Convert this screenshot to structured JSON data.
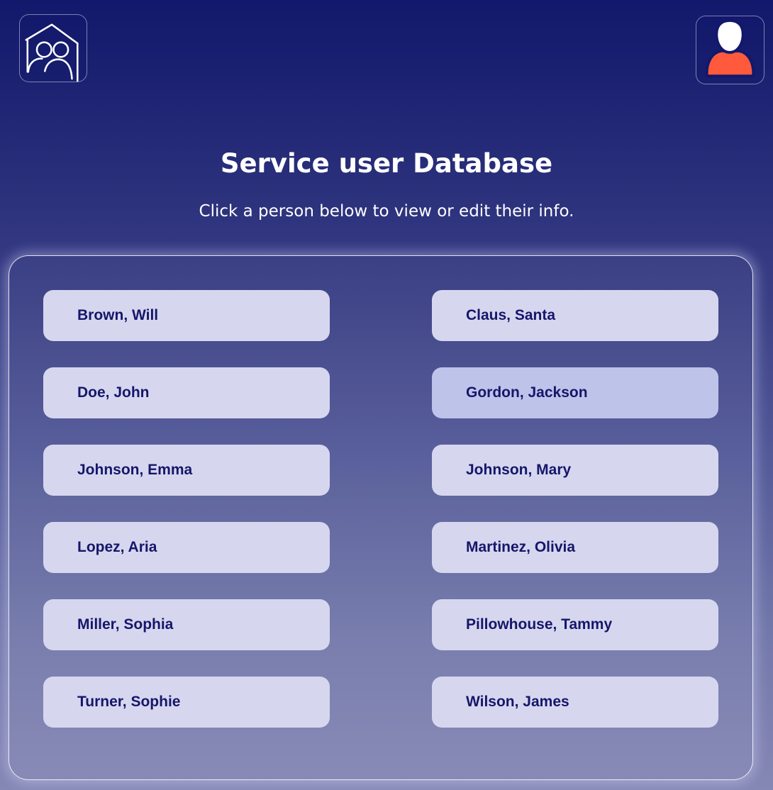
{
  "header": {
    "home_icon": "home-people-icon",
    "profile_icon": "user-avatar-icon",
    "profile_colors": {
      "head": "#ffffff",
      "body": "#ff5a3c",
      "outline": "#12186b"
    }
  },
  "page": {
    "title": "Service user Database",
    "subtitle": "Click a person below to view or edit their info."
  },
  "people": [
    {
      "name": "Brown, Will"
    },
    {
      "name": "Claus, Santa"
    },
    {
      "name": "Doe, John"
    },
    {
      "name": "Gordon, Jackson",
      "hovered": true
    },
    {
      "name": "Johnson, Emma"
    },
    {
      "name": "Johnson, Mary"
    },
    {
      "name": "Lopez, Aria"
    },
    {
      "name": "Martinez, Olivia"
    },
    {
      "name": "Miller, Sophia"
    },
    {
      "name": "Pillowhouse, Tammy"
    },
    {
      "name": "Turner, Sophie"
    },
    {
      "name": "Wilson, James"
    }
  ],
  "colors": {
    "card_background": "#d6d7ef",
    "card_hover_background": "#bec3e9",
    "card_text": "#16166a",
    "background_top": "#12186b",
    "background_bottom": "#8587b4"
  }
}
